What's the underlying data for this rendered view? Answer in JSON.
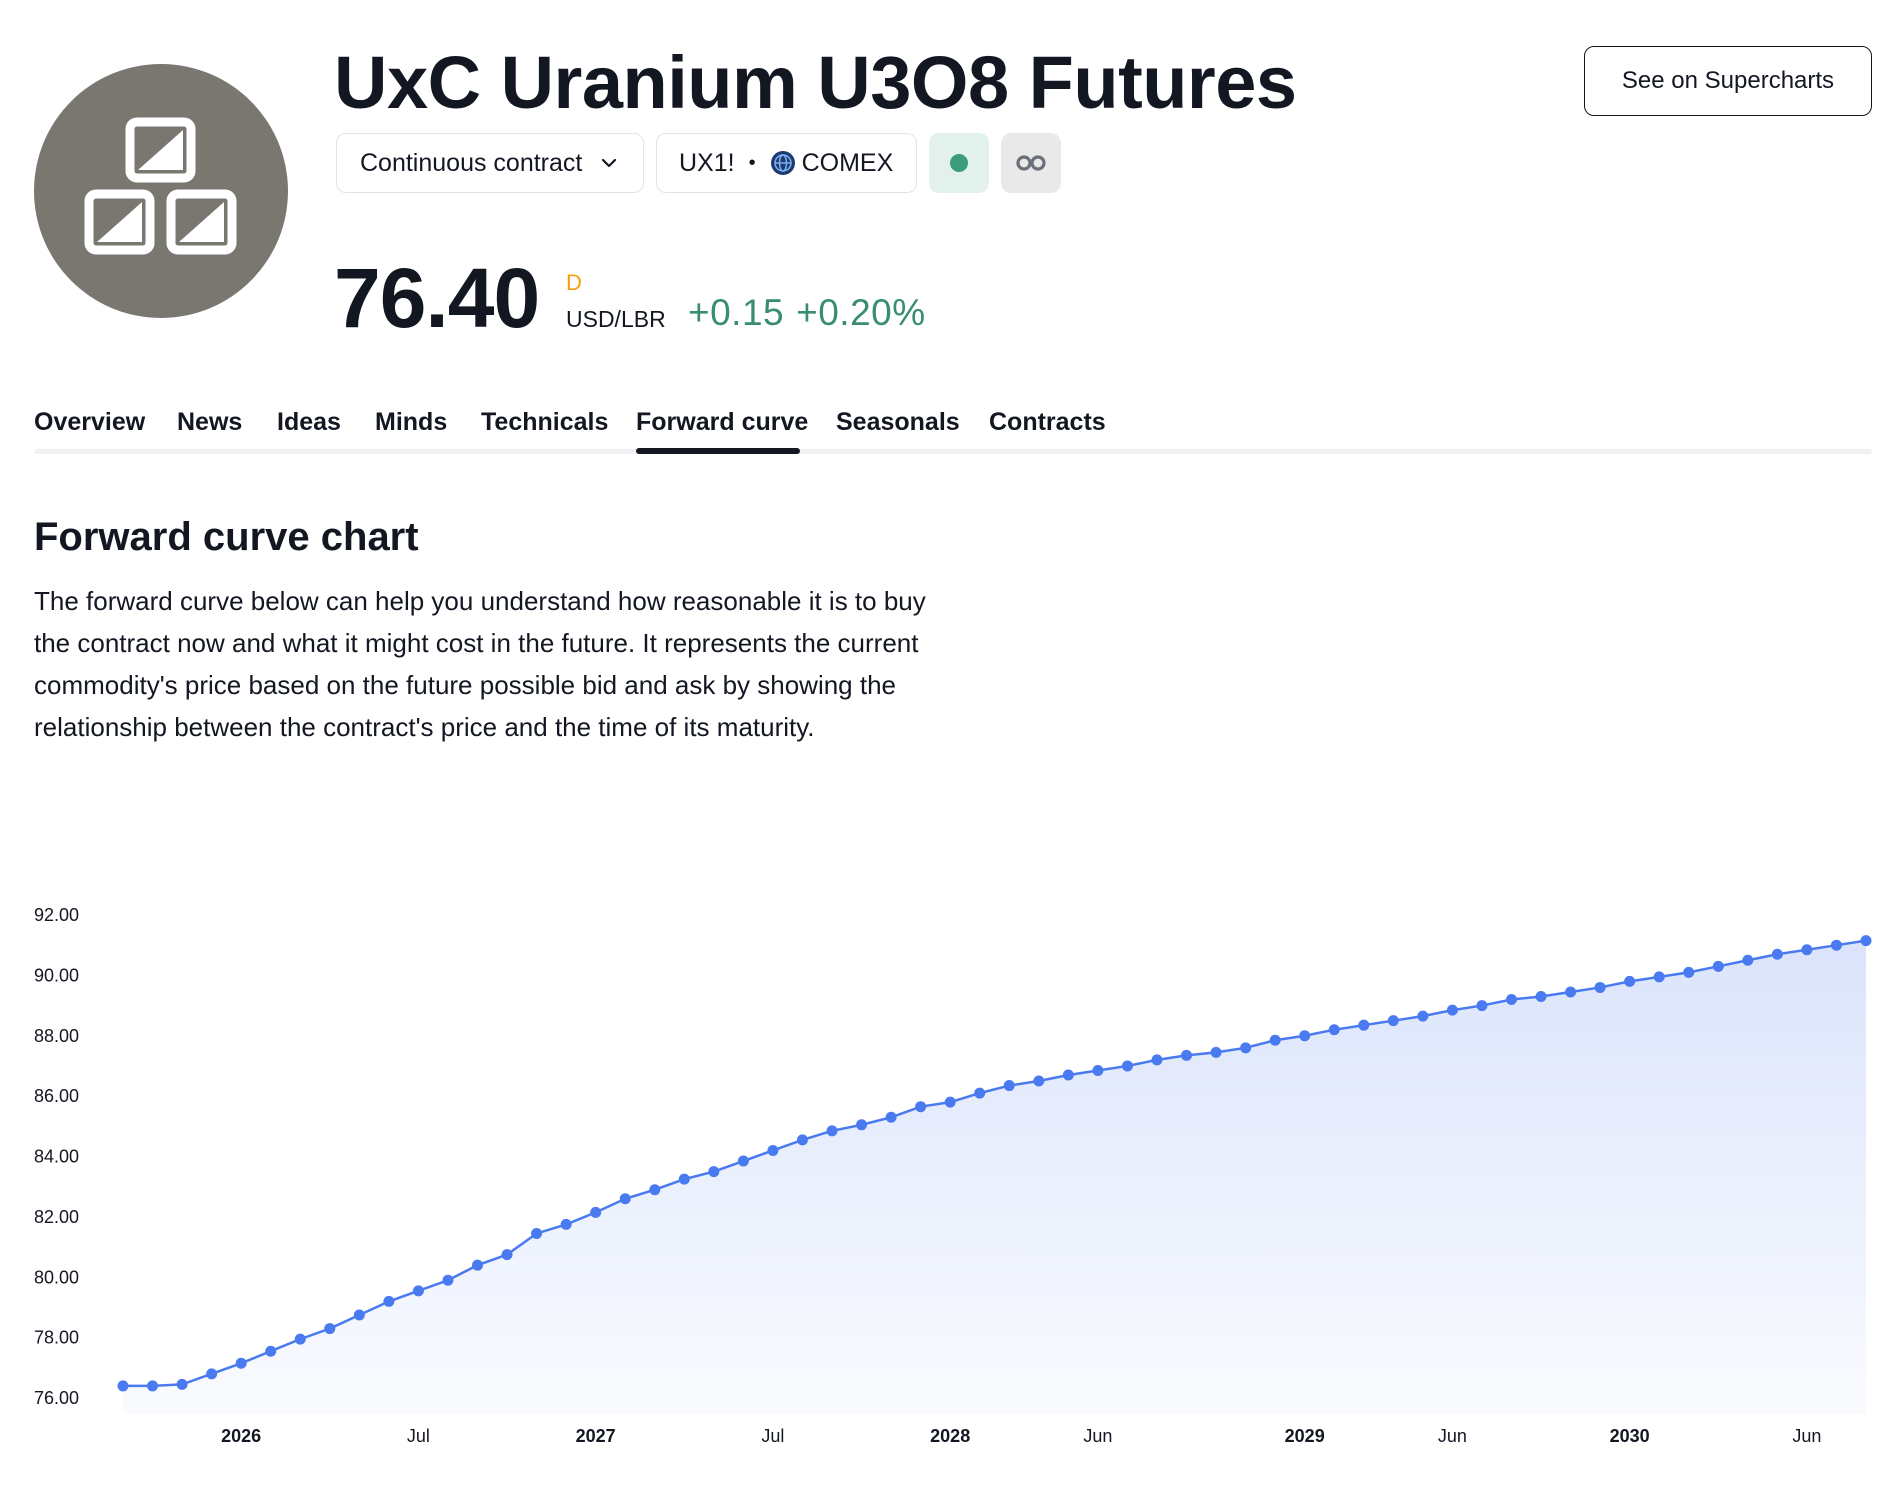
{
  "header": {
    "title": "UxC Uranium U3O8 Futures",
    "supercharts_button": "See on Supercharts",
    "contract_selector": "Continuous contract",
    "symbol": "UX1!",
    "exchange": "COMEX",
    "icon": "commodity-blocks-icon"
  },
  "quote": {
    "price": "76.40",
    "flag": "D",
    "unit": "USD/LBR",
    "change": "+0.15",
    "change_percent": "+0.20%",
    "change_color": "#388e6f"
  },
  "tabs": [
    "Overview",
    "News",
    "Ideas",
    "Minds",
    "Technicals",
    "Forward curve",
    "Seasonals",
    "Contracts"
  ],
  "active_tab": "Forward curve",
  "section": {
    "title": "Forward curve chart",
    "description": "The forward curve below can help you understand how reasonable it is to buy the contract now and what it might cost in the future. It represents the current commodity's price based on the future possible bid and ask by showing the relationship between the contract's price and the time of its maturity."
  },
  "chart_data": {
    "type": "area",
    "title": "",
    "xlabel": "",
    "ylabel": "",
    "ylim": [
      76,
      92
    ],
    "y_ticks": [
      "92.00",
      "90.00",
      "88.00",
      "86.00",
      "84.00",
      "82.00",
      "80.00",
      "78.00",
      "76.00"
    ],
    "x_ticks": [
      {
        "label": "2026",
        "month": 12,
        "bold": true
      },
      {
        "label": "Jul",
        "month": 18,
        "bold": false
      },
      {
        "label": "2027",
        "month": 24,
        "bold": true
      },
      {
        "label": "Jul",
        "month": 30,
        "bold": false
      },
      {
        "label": "2028",
        "month": 36,
        "bold": true
      },
      {
        "label": "Jun",
        "month": 41,
        "bold": false
      },
      {
        "label": "2029",
        "month": 48,
        "bold": true
      },
      {
        "label": "Jun",
        "month": 53,
        "bold": false
      },
      {
        "label": "2030",
        "month": 59,
        "bold": true
      },
      {
        "label": "Jun",
        "month": 65,
        "bold": false
      }
    ],
    "x_start": "2025-09",
    "x_step": "1 month",
    "values": [
      76.4,
      76.4,
      76.45,
      76.8,
      77.15,
      77.55,
      77.95,
      78.3,
      78.75,
      79.2,
      79.55,
      79.9,
      80.4,
      80.75,
      81.45,
      81.75,
      82.15,
      82.6,
      82.9,
      83.25,
      83.5,
      83.85,
      84.2,
      84.55,
      84.85,
      85.05,
      85.3,
      85.65,
      85.8,
      86.1,
      86.35,
      86.5,
      86.7,
      86.85,
      87.0,
      87.2,
      87.35,
      87.45,
      87.6,
      87.85,
      88.0,
      88.2,
      88.35,
      88.5,
      88.65,
      88.85,
      89.0,
      89.2,
      89.3,
      89.45,
      89.6,
      89.8,
      89.95,
      90.1,
      90.3,
      90.5,
      90.7,
      90.85,
      91.0,
      91.15
    ],
    "line_color": "#4a7af0",
    "fill_color": "#dbe4fb",
    "grid": false
  }
}
